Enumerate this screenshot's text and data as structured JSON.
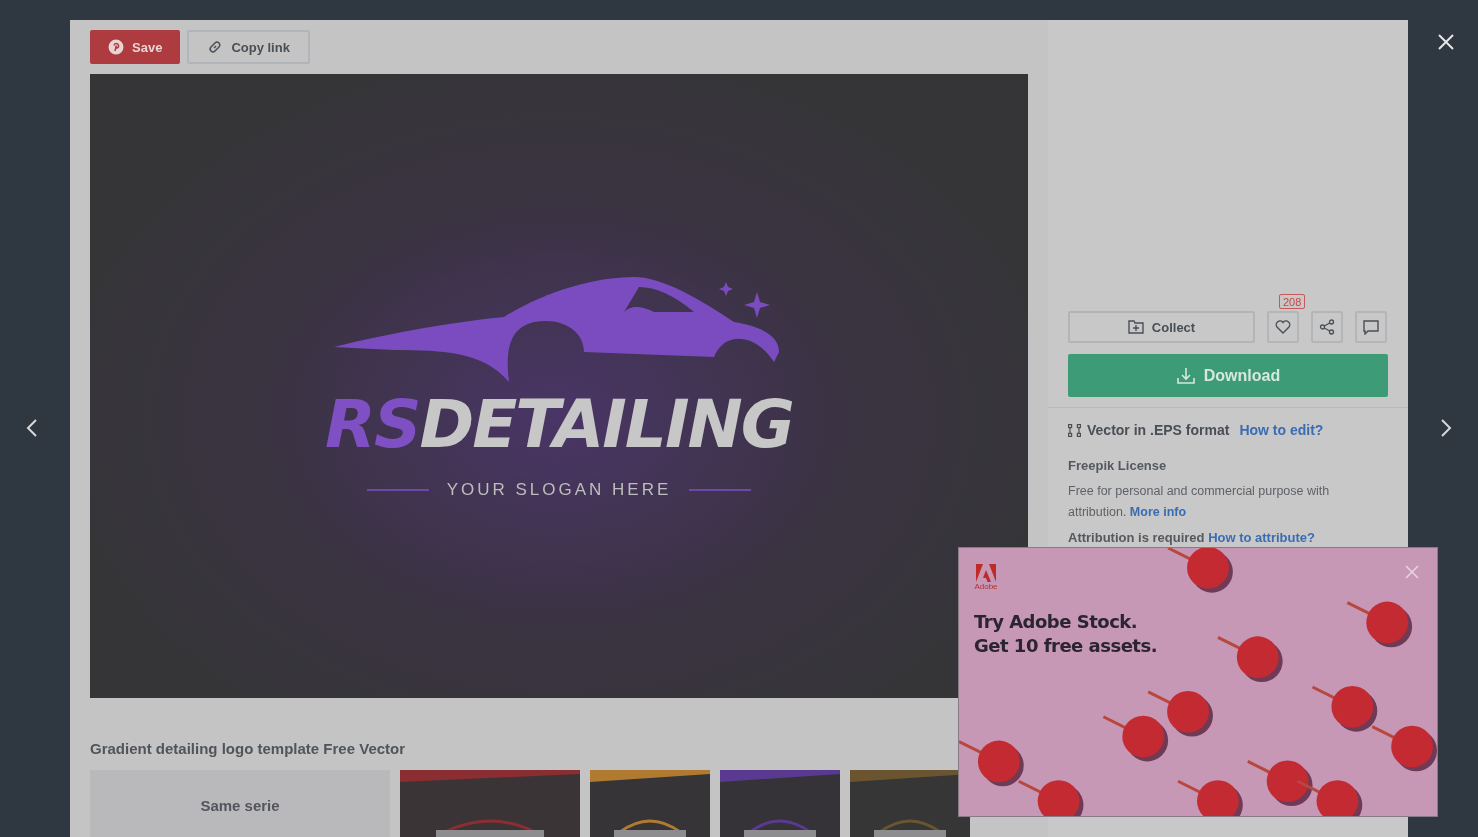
{
  "toolbar": {
    "buttons": [
      {
        "kind": "pinterest",
        "label": "Save"
      },
      {
        "kind": "link",
        "label": "Copy link"
      }
    ]
  },
  "preview": {
    "kind": "logo",
    "initials": "RS",
    "name": "DETAILING",
    "slogan": "YOUR SLOGAN HERE"
  },
  "title": "Gradient detailing logo template Free Vector",
  "related": [
    {
      "kind": "series",
      "label": "Same serie"
    },
    {
      "kind": "picture"
    },
    {
      "kind": "picture"
    },
    {
      "kind": "picture"
    },
    {
      "kind": "picture"
    }
  ],
  "actions": {
    "collect": "Collect",
    "likes": "208",
    "download": "Download"
  },
  "format": {
    "text": "Vector in .EPS format",
    "link": "How to edit?"
  },
  "license": {
    "title": "Freepik License",
    "text": "Free for personal and commercial purpose with attribution.",
    "link": "More info"
  },
  "attribution": {
    "text": "Attribution is required",
    "link": "How to attribute?"
  },
  "ad": {
    "brand": "Adobe",
    "headline": [
      "Try Adobe Stock.",
      "Get 10 free assets."
    ]
  }
}
